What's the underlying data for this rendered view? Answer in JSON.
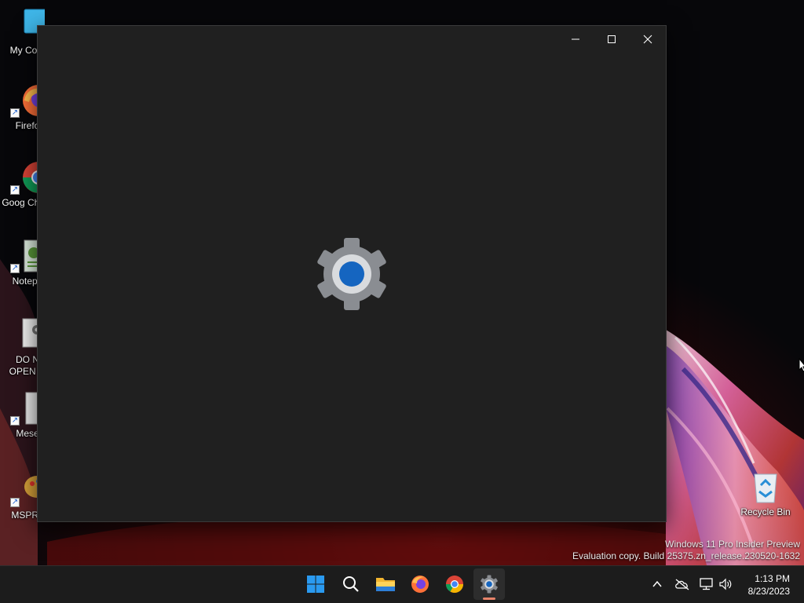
{
  "desktop": {
    "icons": [
      {
        "label": "My Com",
        "icon": "computer-icon"
      },
      {
        "label": "Firefo",
        "icon": "firefox-icon"
      },
      {
        "label": "Goog Chron",
        "icon": "chrome-icon"
      },
      {
        "label": "Notepa",
        "icon": "notepad-icon"
      },
      {
        "label": "DO N OPEN O",
        "icon": "settings-file-icon"
      },
      {
        "label": "Mese",
        "icon": "blank-file-icon"
      },
      {
        "label": "MSPRa",
        "icon": "mspaint-icon"
      }
    ],
    "recycle_bin": {
      "label": "Recycle Bin",
      "icon": "recycle-bin-icon"
    }
  },
  "window": {
    "app": "Settings",
    "state": "loading",
    "splash_icon": "settings-gear-icon",
    "controls": {
      "minimize": "minimize-icon",
      "maximize": "maximize-icon",
      "close": "close-icon"
    }
  },
  "watermark": {
    "line1": "Windows 11 Pro Insider Preview",
    "line2": "Evaluation copy. Build 25375.zn_release.230520-1632"
  },
  "taskbar": {
    "apps": [
      {
        "name": "start",
        "icon": "windows-start-icon"
      },
      {
        "name": "search",
        "icon": "search-icon"
      },
      {
        "name": "file-explorer",
        "icon": "folder-icon"
      },
      {
        "name": "firefox",
        "icon": "firefox-icon"
      },
      {
        "name": "chrome",
        "icon": "chrome-icon"
      },
      {
        "name": "settings",
        "icon": "settings-gear-icon",
        "active": true
      }
    ],
    "tray": {
      "icons": [
        "chevron-up-icon",
        "onedrive-offline-icon",
        "network-icon",
        "volume-icon"
      ],
      "time": "1:13 PM",
      "date": "8/23/2023"
    }
  },
  "colors": {
    "window_bg": "#202020",
    "taskbar_bg": "#1c1c1c",
    "gear_gray": "#8a8d92",
    "gear_blue": "#1565c0",
    "active_indicator": "#e8846a"
  }
}
